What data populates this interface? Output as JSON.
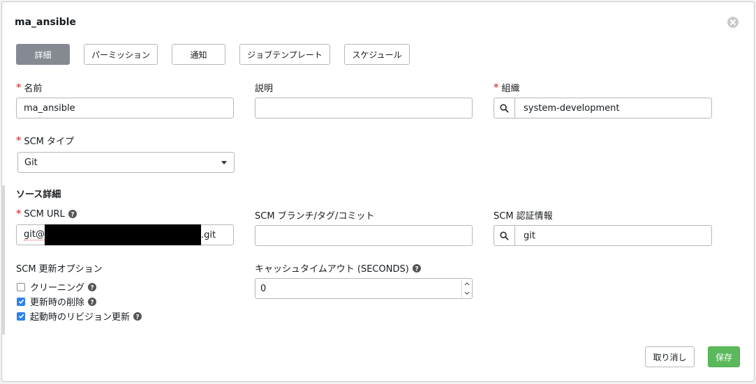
{
  "title": "ma_ansible",
  "tabs": [
    {
      "label": "詳細",
      "active": true
    },
    {
      "label": "パーミッション",
      "active": false
    },
    {
      "label": "通知",
      "active": false
    },
    {
      "label": "ジョブテンプレート",
      "active": false
    },
    {
      "label": "スケジュール",
      "active": false
    }
  ],
  "fields": {
    "name": {
      "label": "名前",
      "value": "ma_ansible"
    },
    "description": {
      "label": "説明",
      "value": ""
    },
    "organization": {
      "label": "組織",
      "value": "system-development"
    },
    "scm_type": {
      "label": "SCM タイプ",
      "value": "Git"
    }
  },
  "source": {
    "title": "ソース詳細",
    "scm_url": {
      "label": "SCM URL",
      "prefix": "git@",
      "suffix": ".git"
    },
    "scm_branch": {
      "label": "SCM ブランチ/タグ/コミット",
      "value": ""
    },
    "scm_credential": {
      "label": "SCM 認証情報",
      "value": "git"
    },
    "update_options": {
      "label": "SCM 更新オプション",
      "options": [
        {
          "label": "クリーニング",
          "checked": false
        },
        {
          "label": "更新時の削除",
          "checked": true
        },
        {
          "label": "起動時のリビジョン更新",
          "checked": true
        }
      ]
    },
    "cache_timeout": {
      "label": "キャッシュタイムアウト (SECONDS)",
      "value": "0"
    }
  },
  "buttons": {
    "cancel": "取り消し",
    "save": "保存"
  },
  "icons": {
    "close": "close-icon",
    "search": "search-icon",
    "help": "help-icon"
  },
  "colors": {
    "required": "#d9534f",
    "save": "#5cb85c",
    "tab_active": "#848992",
    "checkbox": "#2f80ed"
  }
}
